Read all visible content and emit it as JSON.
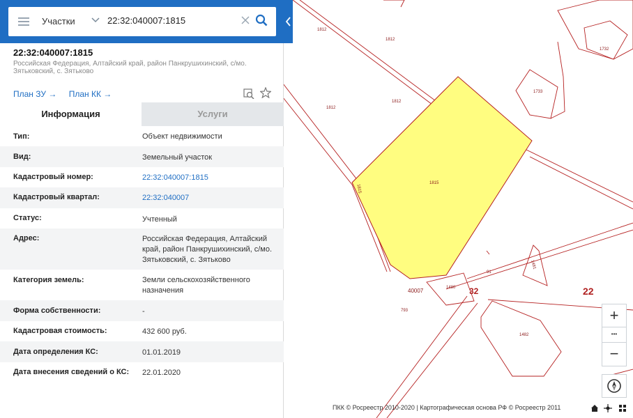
{
  "search": {
    "category": "Участки",
    "query": "22:32:040007:1815"
  },
  "object": {
    "title": "22:32:040007:1815",
    "address": "Российская Федерация, Алтайский край, район Панкрушихинский, с/мо. Зятьковский, с. Зятьково"
  },
  "plans": {
    "plan_zu": "План ЗУ",
    "plan_kk": "План КК"
  },
  "tabs": {
    "info": "Информация",
    "services": "Услуги"
  },
  "rows": [
    {
      "key": "Тип:",
      "value": "Объект недвижимости"
    },
    {
      "key": "Вид:",
      "value": "Земельный участок"
    },
    {
      "key": "Кадастровый номер:",
      "value": "22:32:040007:1815"
    },
    {
      "key": "Кадастровый квартал:",
      "value": "22:32:040007"
    },
    {
      "key": "Статус:",
      "value": "Учтенный"
    },
    {
      "key": "Адрес:",
      "value": "Российская Федерация, Алтайский край, район Панкрушихинский, с/мо. Зятьковский, с. Зятьково"
    },
    {
      "key": "Категория земель:",
      "value": "Земли сельскохозяйственного назначения"
    },
    {
      "key": "Форма собственности:",
      "value": "-"
    },
    {
      "key": "Кадастровая стоимость:",
      "value": "432 600 руб."
    },
    {
      "key": "Дата определения КС:",
      "value": "01.01.2019"
    },
    {
      "key": "Дата внесения сведений о КС:",
      "value": "22.01.2020"
    }
  ],
  "map": {
    "labels": {
      "l1812a": "1812",
      "l1812b": "1812",
      "l1812c": "1812",
      "l1812d": "1812",
      "l1732": "1732",
      "l1733": "1733",
      "l1815": "1815",
      "l1815v": "1815",
      "l91": "91",
      "l1481": "1481",
      "l1480": "1480",
      "l793": "793",
      "l1482": "1482",
      "q40007": "40007",
      "q32": "32",
      "q22": "22"
    },
    "attribution": "ПКК © Росреестр 2010-2020 | Картографическая основа РФ © Росреестр 2011",
    "zoom_in": "+",
    "more": "•••",
    "zoom_out": "−",
    "colors": {
      "parcel_fill": "#fffd80",
      "boundary": "#b52020",
      "accent": "#1f6ec3"
    }
  }
}
